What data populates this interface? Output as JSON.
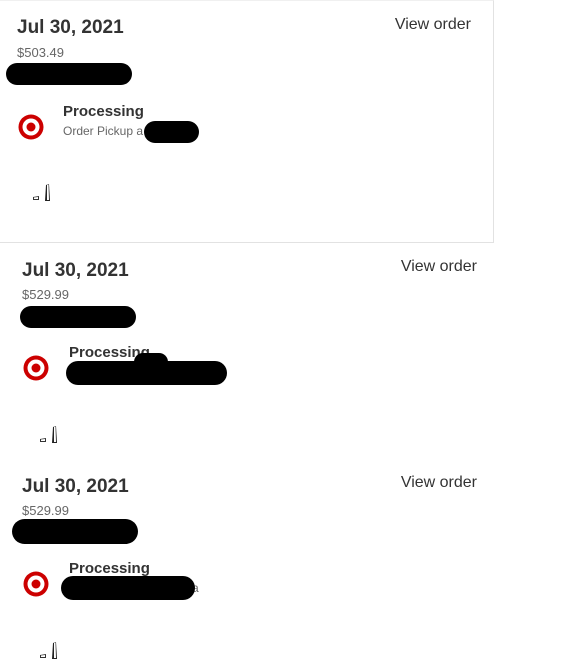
{
  "orders": [
    {
      "date": "Jul 30, 2021",
      "total": "$503.49",
      "view_label": "View order",
      "status": "Processing",
      "detail": "Order Pickup a"
    },
    {
      "date": "Jul 30, 2021",
      "total": "$529.99",
      "view_label": "View order",
      "status": "Processing",
      "detail": ""
    },
    {
      "date": "Jul 30, 2021",
      "total": "$529.99",
      "view_label": "View order",
      "status": "Processing",
      "detail": "a"
    }
  ],
  "icons": {
    "store_logo": "target-bullseye-icon",
    "product": "console-product-icon"
  },
  "colors": {
    "brand_red": "#cc0000",
    "redaction": "#000000"
  }
}
